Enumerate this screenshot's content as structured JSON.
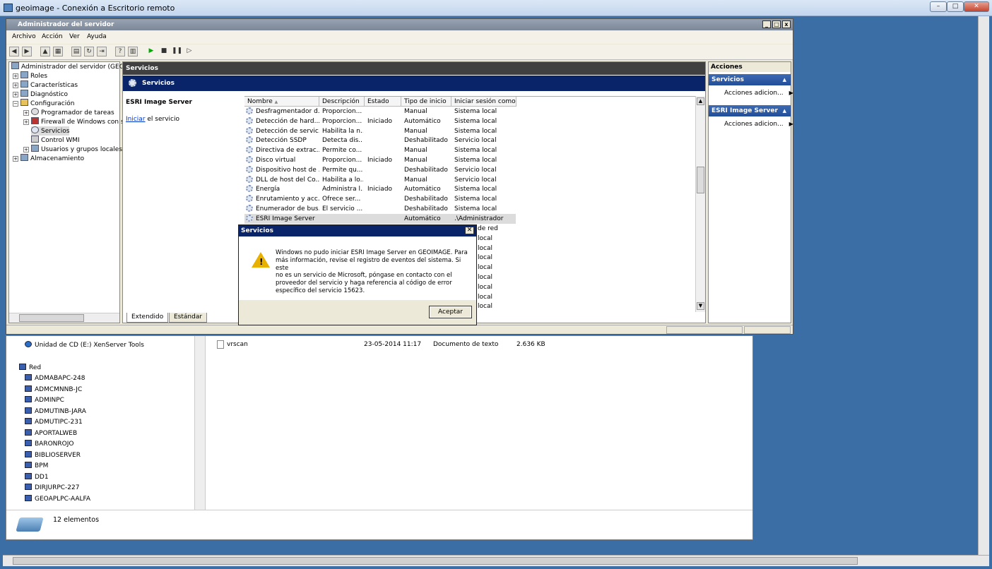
{
  "rdp": {
    "title": "geoimage - Conexión a Escritorio remoto",
    "min": "–",
    "max": "□",
    "close": "✕"
  },
  "server_manager": {
    "title": "Administrador del servidor",
    "menu": [
      "Archivo",
      "Acción",
      "Ver",
      "Ayuda"
    ],
    "tree": {
      "root": "Administrador del servidor (GEOIMA",
      "roles": "Roles",
      "features": "Características",
      "diagnostics": "Diagnóstico",
      "config": "Configuración",
      "task_scheduler": "Programador de tareas",
      "firewall": "Firewall de Windows con se",
      "services": "Servicios",
      "wmi": "Control WMI",
      "users": "Usuarios y grupos locales",
      "storage": "Almacenamiento"
    },
    "center": {
      "header": "Servicios",
      "band": "Servicios",
      "selected_service": "ESRI Image Server",
      "start_link": "Iniciar",
      "start_rest": " el servicio",
      "tab_extended": "Extendido",
      "tab_standard": "Estándar"
    },
    "columns": {
      "name": "Nombre",
      "desc": "Descripción",
      "state": "Estado",
      "startup": "Tipo de inicio",
      "logon": "Iniciar sesión como"
    },
    "rows": [
      {
        "name": "Desfragmentador d...",
        "desc": "Proporcion...",
        "state": "",
        "startup": "Manual",
        "logon": "Sistema local"
      },
      {
        "name": "Detección de hard...",
        "desc": "Proporcion...",
        "state": "Iniciado",
        "startup": "Automático",
        "logon": "Sistema local"
      },
      {
        "name": "Detección de servic...",
        "desc": "Habilita la n...",
        "state": "",
        "startup": "Manual",
        "logon": "Sistema local"
      },
      {
        "name": "Detección SSDP",
        "desc": "Detecta dis...",
        "state": "",
        "startup": "Deshabilitado",
        "logon": "Servicio local"
      },
      {
        "name": "Directiva de extrac...",
        "desc": "Permite co...",
        "state": "",
        "startup": "Manual",
        "logon": "Sistema local"
      },
      {
        "name": "Disco virtual",
        "desc": "Proporcion...",
        "state": "Iniciado",
        "startup": "Manual",
        "logon": "Sistema local"
      },
      {
        "name": "Dispositivo host de ...",
        "desc": "Permite qu...",
        "state": "",
        "startup": "Deshabilitado",
        "logon": "Servicio local"
      },
      {
        "name": "DLL de host del Co...",
        "desc": "Habilita a lo...",
        "state": "",
        "startup": "Manual",
        "logon": "Servicio local"
      },
      {
        "name": "Energía",
        "desc": "Administra l...",
        "state": "Iniciado",
        "startup": "Automático",
        "logon": "Sistema local"
      },
      {
        "name": "Enrutamiento y acc...",
        "desc": "Ofrece ser...",
        "state": "",
        "startup": "Deshabilitado",
        "logon": "Sistema local"
      },
      {
        "name": "Enumerador de bus...",
        "desc": "El servicio ...",
        "state": "",
        "startup": "Deshabilitado",
        "logon": "Sistema local"
      },
      {
        "name": "ESRI Image Server",
        "desc": "",
        "state": "",
        "startup": "Automático",
        "logon": ".\\Administrador"
      }
    ],
    "hidden_logon": [
      "de red",
      "local",
      "local",
      "local",
      "local",
      "local",
      "local",
      "local",
      "local"
    ],
    "actions": {
      "header": "Acciones",
      "sec1": "Servicios",
      "sec2": "ESRI Image Server",
      "more": "Acciones adicion..."
    }
  },
  "dialog": {
    "title": "Servicios",
    "line1": "Windows no pudo iniciar ESRI Image Server en GEOIMAGE. Para",
    "line2": "más información, revise el registro de eventos del sistema. Si este",
    "line3": "no es un servicio de Microsoft, póngase en contacto con el",
    "line4": "proveedor del servicio y haga referencia al código de error",
    "line5": "específico del servicio 15623.",
    "ok": "Aceptar"
  },
  "explorer": {
    "cd_drive": "Unidad de CD (E:) XenServer Tools",
    "network": "Red",
    "computers": [
      "ADMABAPC-248",
      "ADMCMNNB-JC",
      "ADMINPC",
      "ADMUTINB-JARA",
      "ADMUTIPC-231",
      "APORTALWEB",
      "BARONROJO",
      "BIBLIOSERVER",
      "BPM",
      "DD1",
      "DIRJURPC-227",
      "GEOAPLPC-AALFA"
    ],
    "file": {
      "name": "vrscan",
      "date": "23-05-2014 11:17",
      "type": "Documento de texto",
      "size": "2.636 KB"
    },
    "status": "12 elementos"
  }
}
